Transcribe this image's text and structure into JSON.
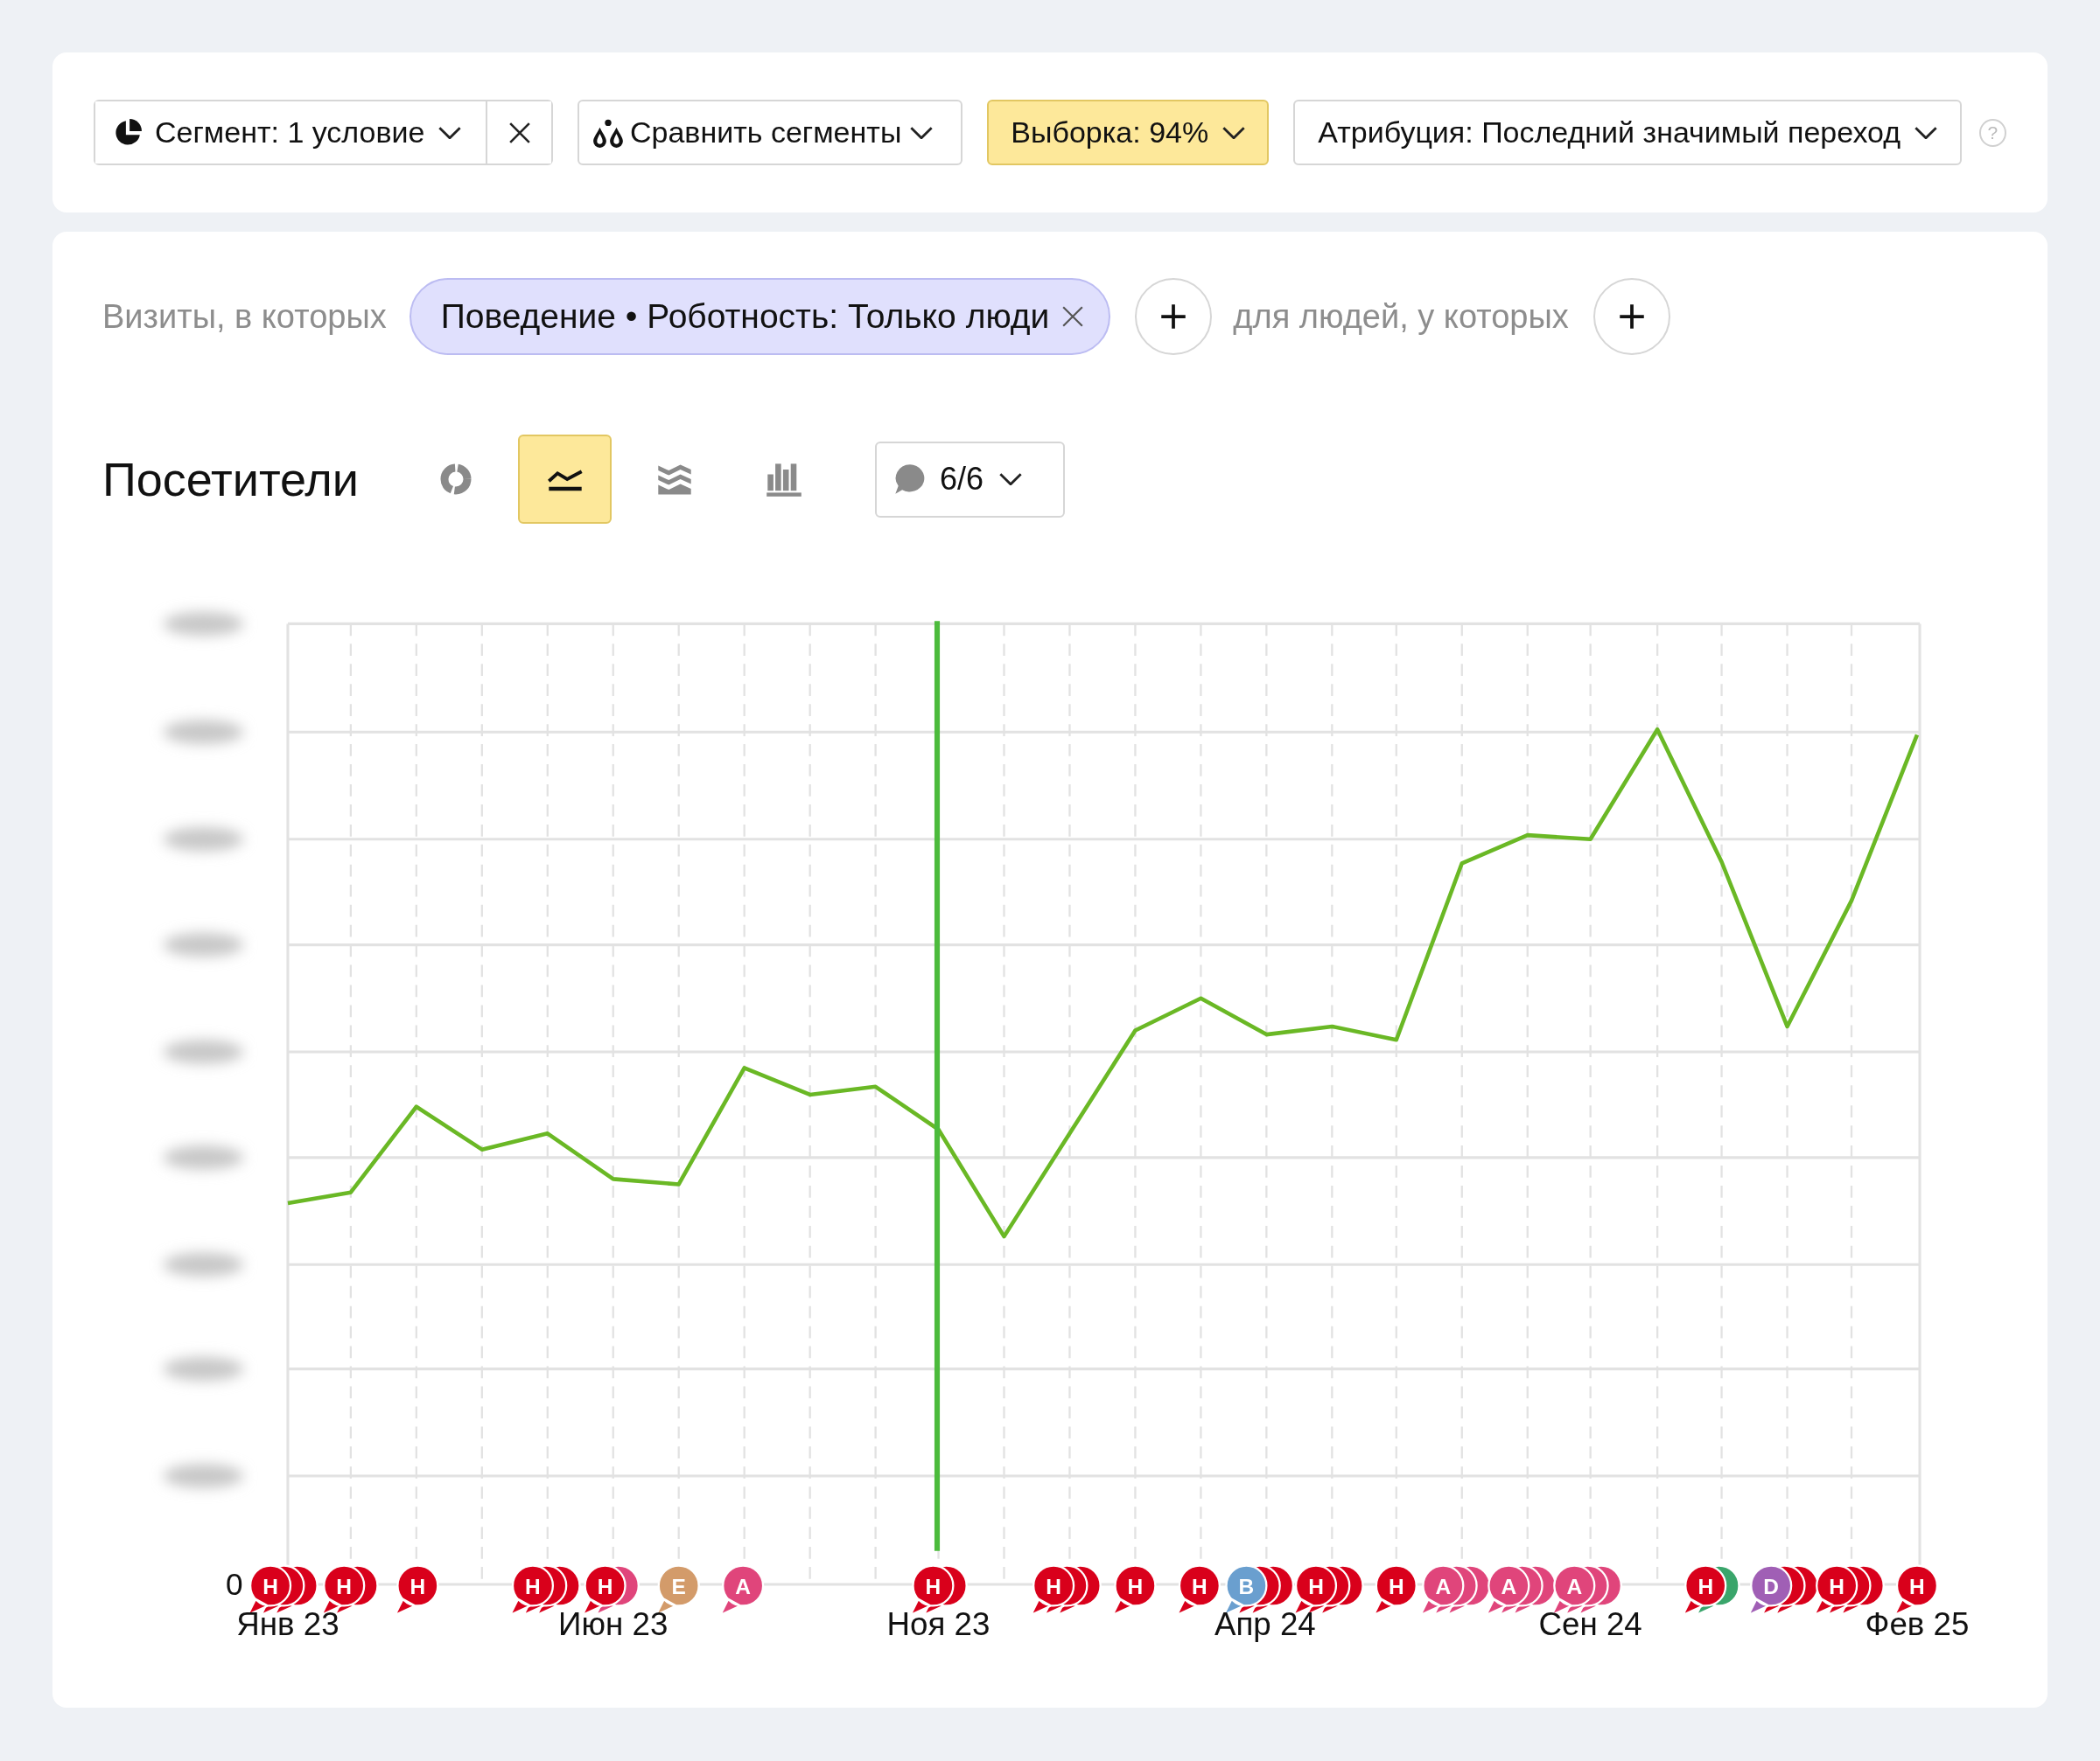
{
  "toolbar": {
    "segment": {
      "label": "Сегмент: 1 условие"
    },
    "compare": {
      "label": "Сравнить сегменты"
    },
    "sample": {
      "label": "Выборка: 94%"
    },
    "attribution": {
      "label": "Атрибуция: Последний значимый переход"
    },
    "help": "?"
  },
  "segment_builder": {
    "visits_label": "Визиты, в которых",
    "condition": "Поведение • Роботность: Только люди",
    "people_label": "для людей, у которых"
  },
  "report": {
    "title": "Посетители",
    "chart_types": [
      {
        "kind": "pie",
        "selected": false
      },
      {
        "kind": "line",
        "selected": true
      },
      {
        "kind": "area",
        "selected": false
      },
      {
        "kind": "bar",
        "selected": false
      }
    ],
    "annotations_filter": {
      "label": "6/6"
    },
    "chart": {
      "zero_label": "0",
      "x_labels": [
        "Янв 23",
        "Июн 23",
        "Ноя 23",
        "Апр 24",
        "Сен 24",
        "Фев 25"
      ],
      "annotations": [
        {
          "markers": [
            {
              "letter": "Н",
              "color": "#d9001b"
            },
            {
              "color": "#d9001b"
            },
            {
              "color": "#d9001b"
            }
          ]
        },
        {
          "markers": [
            {
              "letter": "Н",
              "color": "#d9001b"
            },
            {
              "color": "#d9001b"
            }
          ]
        },
        {
          "markers": [
            {
              "letter": "Н",
              "color": "#d9001b"
            }
          ]
        },
        {
          "markers": [
            {
              "letter": "Н",
              "color": "#d9001b"
            },
            {
              "color": "#d9001b"
            },
            {
              "color": "#d9001b"
            }
          ]
        },
        {
          "markers": [
            {
              "letter": "Н",
              "color": "#d9001b"
            },
            {
              "color": "#e0457b"
            }
          ]
        },
        {
          "markers": [
            {
              "letter": "E",
              "color": "#d39b6a"
            }
          ]
        },
        {
          "markers": [
            {
              "letter": "A",
              "color": "#e0457b"
            }
          ]
        },
        {
          "markers": [
            {
              "letter": "Н",
              "color": "#d9001b"
            },
            {
              "color": "#d9001b"
            }
          ]
        },
        {
          "markers": [
            {
              "letter": "Н",
              "color": "#d9001b"
            },
            {
              "color": "#d9001b"
            },
            {
              "color": "#d9001b"
            }
          ]
        },
        {
          "markers": [
            {
              "letter": "Н",
              "color": "#d9001b"
            }
          ]
        },
        {
          "markers": [
            {
              "letter": "Н",
              "color": "#d9001b"
            }
          ]
        },
        {
          "markers": [
            {
              "letter": "B",
              "color": "#6a9fcf"
            },
            {
              "color": "#d9001b"
            },
            {
              "color": "#d9001b"
            }
          ]
        },
        {
          "markers": [
            {
              "letter": "Н",
              "color": "#d9001b"
            },
            {
              "color": "#d9001b"
            },
            {
              "color": "#d9001b"
            }
          ]
        },
        {
          "markers": [
            {
              "letter": "Н",
              "color": "#d9001b"
            }
          ]
        },
        {
          "markers": [
            {
              "letter": "A",
              "color": "#e0457b"
            },
            {
              "color": "#e0457b"
            },
            {
              "color": "#e0457b"
            }
          ]
        },
        {
          "markers": [
            {
              "letter": "A",
              "color": "#e0457b"
            },
            {
              "color": "#e0457b"
            },
            {
              "color": "#e0457b"
            }
          ]
        },
        {
          "markers": [
            {
              "letter": "A",
              "color": "#e0457b"
            },
            {
              "color": "#e0457b"
            },
            {
              "color": "#e0457b"
            }
          ]
        },
        {
          "markers": [
            {
              "letter": "Н",
              "color": "#d9001b"
            },
            {
              "color": "#3aa56b"
            }
          ]
        },
        {
          "markers": [
            {
              "letter": "D",
              "color": "#a05fb5"
            },
            {
              "color": "#d9001b"
            },
            {
              "color": "#d9001b"
            }
          ]
        },
        {
          "markers": [
            {
              "letter": "Н",
              "color": "#d9001b"
            },
            {
              "color": "#d9001b"
            },
            {
              "color": "#d9001b"
            }
          ]
        },
        {
          "markers": [
            {
              "letter": "Н",
              "color": "#d9001b"
            }
          ]
        }
      ]
    }
  }
}
